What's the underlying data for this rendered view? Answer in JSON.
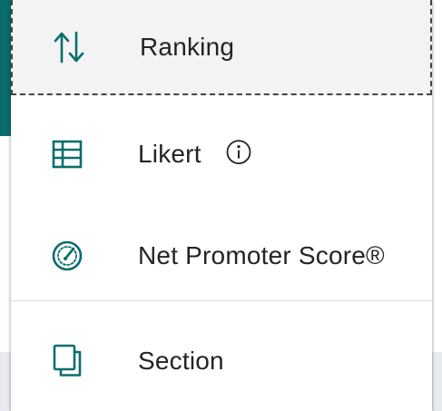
{
  "menu": {
    "items": [
      {
        "label": "Ranking",
        "icon": "ranking-arrows-icon"
      },
      {
        "label": "Likert",
        "icon": "likert-grid-icon",
        "info_icon": "info-icon"
      },
      {
        "label": "Net Promoter Score®",
        "icon": "gauge-icon"
      },
      {
        "label": "Section",
        "icon": "section-pages-icon"
      }
    ]
  },
  "colors": {
    "accent": "#0a6d6d",
    "text": "#252423",
    "hover_background": "#f3f3f3"
  }
}
